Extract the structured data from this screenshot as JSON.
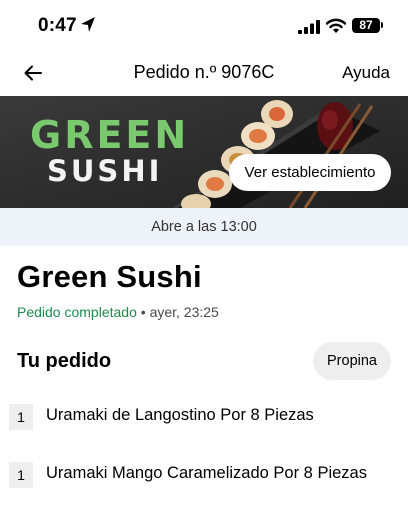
{
  "status_bar": {
    "time": "0:47",
    "battery": "87",
    "icons": [
      "location-arrow-icon",
      "signal-icon",
      "wifi-icon",
      "battery-icon"
    ]
  },
  "nav": {
    "title": "Pedido n.º 9076C",
    "help": "Ayuda",
    "back_icon": "back-arrow-icon"
  },
  "banner": {
    "brand_line1": "GREEN",
    "brand_line2": "SUSHI",
    "store_button": "Ver establecimiento",
    "brand_color": "#7bc96f"
  },
  "opens_text": "Abre a las 13:00",
  "restaurant": {
    "name": "Green Sushi",
    "status": "Pedido completado",
    "separator": " • ",
    "time": "ayer, 23:25",
    "status_color": "#1f8a4c"
  },
  "order": {
    "title": "Tu pedido",
    "tip_button": "Propina",
    "items": [
      {
        "qty": "1",
        "name": "Uramaki de Langostino Por 8 Piezas"
      },
      {
        "qty": "1",
        "name": "Uramaki Mango Caramelizado Por 8 Piezas"
      }
    ]
  }
}
